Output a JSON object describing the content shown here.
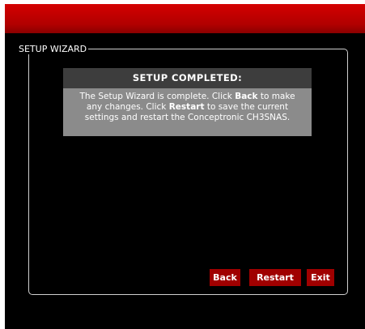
{
  "wizard": {
    "legend": "SETUP WIZARD",
    "header": "SETUP COMPLETED:",
    "message": {
      "part1": "The Setup Wizard is complete.  Click ",
      "back": "Back",
      "part2": " to make any changes.  Click ",
      "restart": "Restart",
      "part3": " to save the current settings and restart the Conceptronic CH3SNAS."
    }
  },
  "buttons": {
    "back": "Back",
    "restart": "Restart",
    "exit": "Exit"
  },
  "colors": {
    "accent_red": "#b10000",
    "button_red": "#a00000",
    "panel_header": "#3d3d3d",
    "panel_body": "#8b8b8b"
  }
}
